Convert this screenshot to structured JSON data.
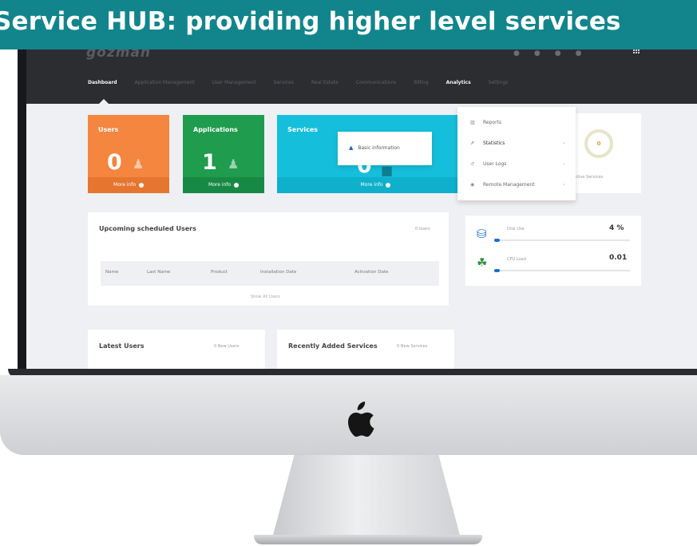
{
  "banner": {
    "title": "Service HUB: providing higher level services"
  },
  "app": {
    "logo": "gozman",
    "nav": [
      {
        "label": "Dashboard",
        "active": true
      },
      {
        "label": "Application Management",
        "active": false
      },
      {
        "label": "User Management",
        "active": false
      },
      {
        "label": "Services",
        "active": false
      },
      {
        "label": "Real Estate",
        "active": false
      },
      {
        "label": "Communications",
        "active": false
      },
      {
        "label": "Billing",
        "active": false
      },
      {
        "label": "Analytics",
        "active": true
      },
      {
        "label": "Settings",
        "active": false
      }
    ]
  },
  "cards": {
    "users": {
      "title": "Users",
      "value": "0",
      "more": "More info",
      "color": "#f5863f"
    },
    "applications": {
      "title": "Applications",
      "value": "1",
      "more": "More info",
      "color": "#1f9c4d"
    },
    "services": {
      "title": "Services",
      "value": "0",
      "more": "More info",
      "color": "#15bfdb"
    }
  },
  "basic_menu": {
    "item": "Basic information",
    "icon": "chart-area-icon"
  },
  "analytics_menu": {
    "items": [
      {
        "label": "Reports",
        "icon": "bar-chart-icon"
      },
      {
        "label": "Statistics",
        "icon": "line-chart-icon",
        "active": true
      },
      {
        "label": "User Logs",
        "icon": "history-icon"
      },
      {
        "label": "Remote Management",
        "icon": "eye-icon"
      }
    ]
  },
  "donut_widget": {
    "value": "0",
    "caption": "Active Services"
  },
  "upcoming": {
    "title": "Upcoming scheduled Users",
    "count": "0 Users",
    "columns": [
      "Name",
      "Last Name",
      "Product",
      "Installation Date",
      "Activation Date"
    ],
    "show_all": "Show All Users"
  },
  "system_stats": {
    "disk": {
      "label": "Disk Use",
      "value": "4 %",
      "fraction": 0.04
    },
    "cpu": {
      "label": "CPU Load",
      "value": "0.01",
      "fraction": 0.01
    }
  },
  "latest_users": {
    "title": "Latest Users",
    "meta": "0 New Users"
  },
  "recent_services": {
    "title": "Recently Added Services",
    "meta": "0 New Services"
  }
}
